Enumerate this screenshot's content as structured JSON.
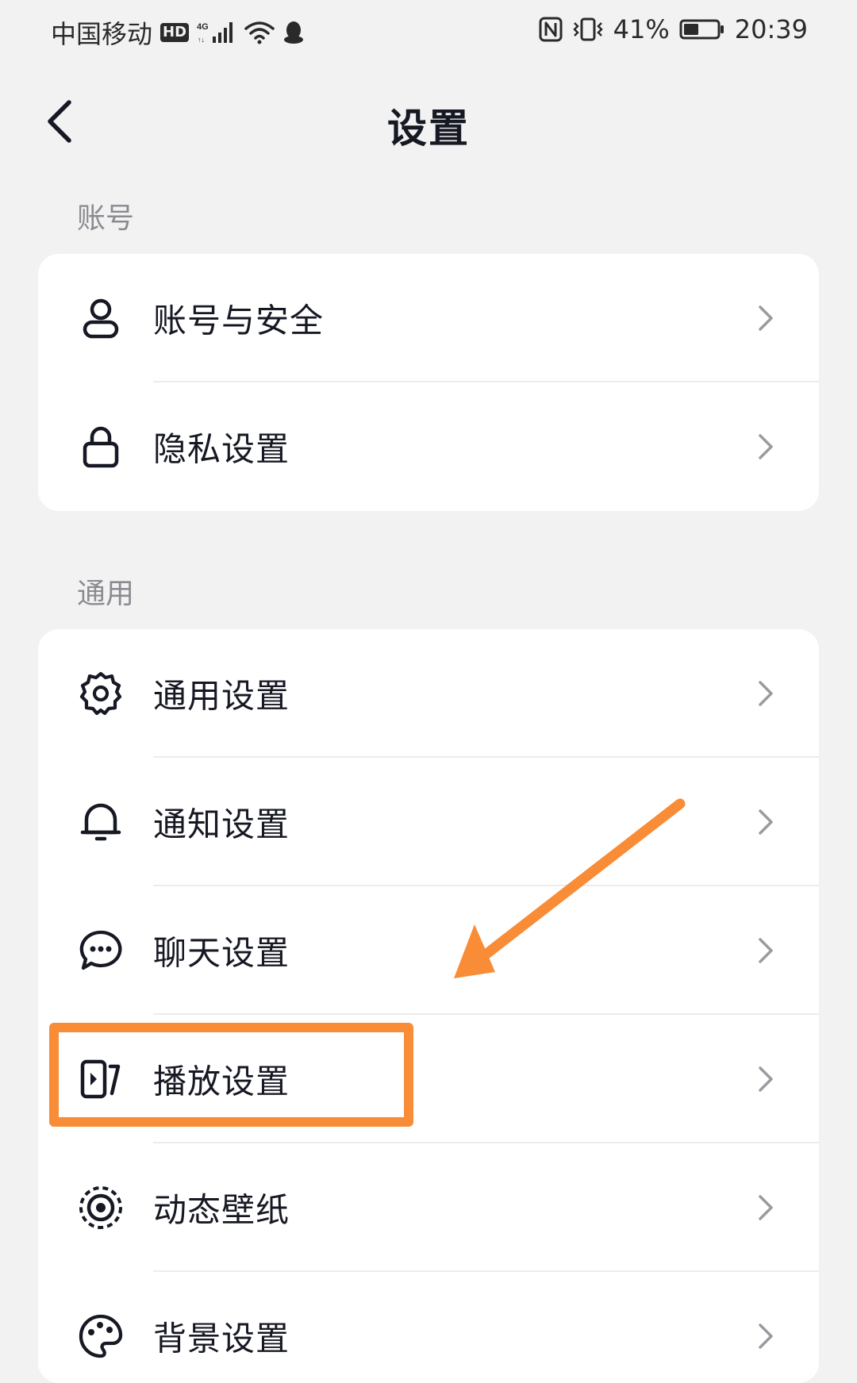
{
  "status_bar": {
    "carrier": "中国移动",
    "hd_badge": "HD",
    "network": "4G",
    "battery_percent": "41%",
    "time": "20:39",
    "icons": [
      "signal-icon",
      "wifi-icon",
      "qq-icon",
      "nfc-icon",
      "vibrate-icon",
      "battery-icon"
    ]
  },
  "header": {
    "title": "设置",
    "back_icon": "chevron-left-icon"
  },
  "sections": {
    "account": {
      "header": "账号",
      "items": [
        {
          "label": "账号与安全",
          "icon": "user-icon"
        },
        {
          "label": "隐私设置",
          "icon": "lock-icon"
        }
      ]
    },
    "general": {
      "header": "通用",
      "items": [
        {
          "label": "通用设置",
          "icon": "gear-icon"
        },
        {
          "label": "通知设置",
          "icon": "bell-icon"
        },
        {
          "label": "聊天设置",
          "icon": "chat-icon"
        },
        {
          "label": "播放设置",
          "icon": "play-icon"
        },
        {
          "label": "动态壁纸",
          "icon": "live-wallpaper-icon"
        },
        {
          "label": "背景设置",
          "icon": "palette-icon"
        }
      ]
    }
  },
  "annotation": {
    "color": "#f98c36",
    "highlighted_item": "播放设置"
  }
}
